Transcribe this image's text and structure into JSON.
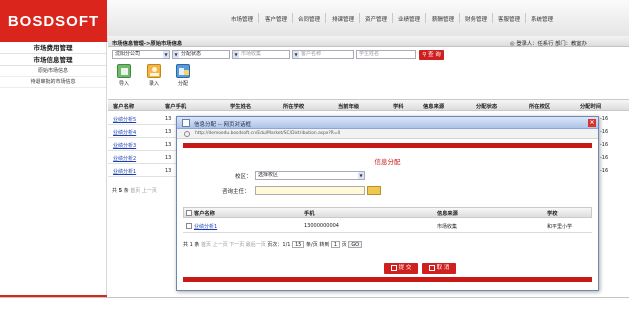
{
  "app": {
    "logo": "BOSDSOFT"
  },
  "topnav": [
    "市场管理",
    "客户管理",
    "合同管理",
    "排课管理",
    "资产管理",
    "业绩管理",
    "薪酬管理",
    "财务管理",
    "客服管理",
    "系统管理"
  ],
  "breadcrumb": "市场信息管理->原始市场信息",
  "user": {
    "text": "登录人：任系行  部门：教室办",
    "exit_glyph": "◎"
  },
  "sidebar": {
    "section1": "市场费用管理",
    "section2": "市场信息管理",
    "items": [
      "原始市场信息",
      "待退审批的市场信息"
    ]
  },
  "filters": {
    "company": "沈阳分公司",
    "status": "分配状态",
    "market": "市场收集",
    "customer_placeholder": "客户名称",
    "student_placeholder": "学生姓名",
    "search_label": "查 询"
  },
  "toolbar": [
    {
      "label": "导入",
      "icon": "import-icon"
    },
    {
      "label": "录入",
      "icon": "entry-icon"
    },
    {
      "label": "分配",
      "icon": "assign-icon"
    }
  ],
  "table": {
    "columns": [
      "客户名称",
      "客户手机",
      "学生姓名",
      "所在学校",
      "当前年级",
      "学科",
      "信息来源",
      "分配状态",
      "所在校区",
      "分配时间"
    ],
    "rows": [
      {
        "name": "业绩分析5",
        "phone": "13",
        "time": "-16"
      },
      {
        "name": "业绩分析4",
        "phone": "13",
        "time": "-16"
      },
      {
        "name": "业绩分析3",
        "phone": "13",
        "time": "-16"
      },
      {
        "name": "业绩分析2",
        "phone": "13",
        "time": "-16"
      },
      {
        "name": "业绩分析1",
        "phone": "13",
        "time": "-16"
      }
    ],
    "pager": {
      "prefix": "共",
      "count": "5",
      "unit": "条",
      "first": "首页",
      "prev": "上一页"
    }
  },
  "modal": {
    "title": "信息分配 -- 网页对话框",
    "url": "http://demoedu.bosdsoft.cn/Edu/Market/SC/Distribution.aspx?R=0",
    "heading": "信息分配",
    "campus_label": "校区：",
    "campus_value": "选择校区",
    "advisor_label": "咨询主任：",
    "columns": [
      "客户名称",
      "手机",
      "信息来源",
      "学校"
    ],
    "row": {
      "name": "业绩分析1",
      "phone": "13000000004",
      "source": "市场收集",
      "school": "和平里小学"
    },
    "pager": {
      "text": "共 1 条",
      "first": "首页",
      "prev": "上一页",
      "next": "下一页",
      "last": "最后一页",
      "page_label": "页次：1/1",
      "per_page": "15",
      "per_page_unit": "条/页",
      "goto_label": "转到",
      "goto_value": "1",
      "page_unit": "页",
      "go": "GO"
    },
    "submit": "提 交",
    "cancel": "取 消"
  }
}
